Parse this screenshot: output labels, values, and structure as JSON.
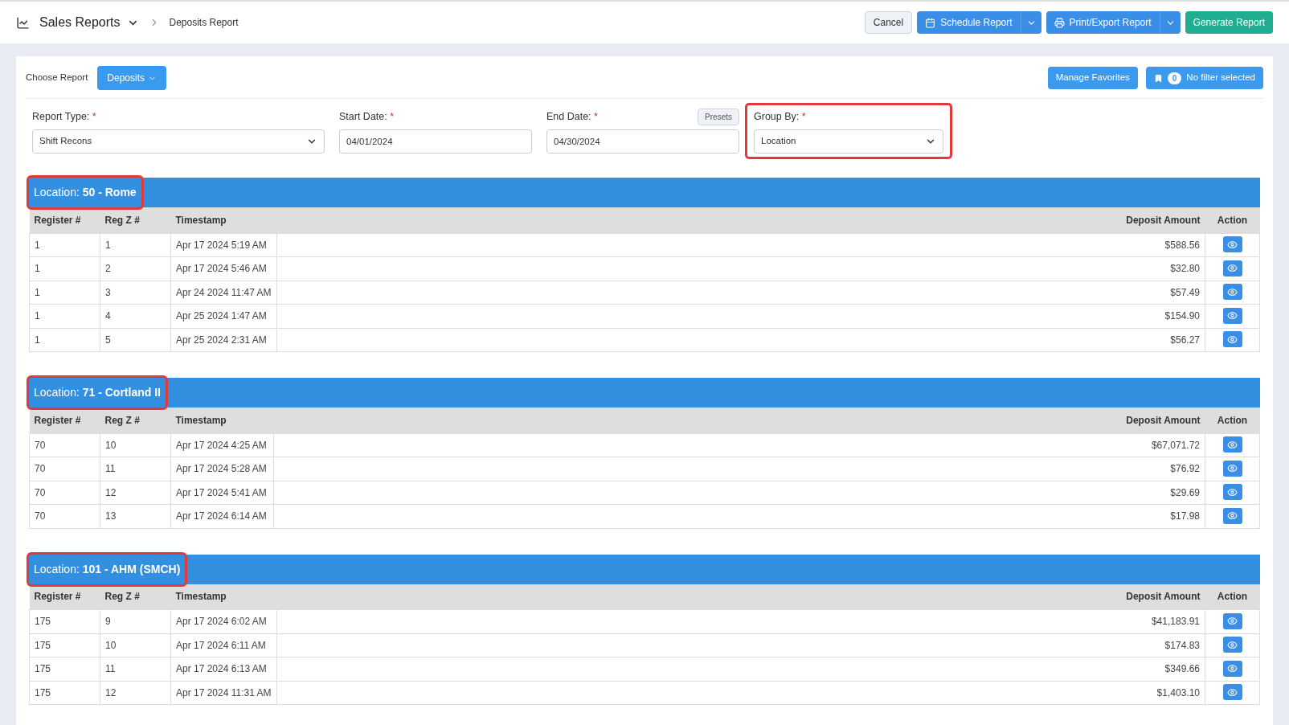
{
  "header": {
    "title": "Sales Reports",
    "breadcrumb": "Deposits Report",
    "buttons": [
      {
        "label": "Cancel",
        "kind": "plain"
      },
      {
        "label": "Schedule Report",
        "kind": "schedule"
      },
      {
        "label": "Print/Export Report",
        "kind": "print"
      },
      {
        "label": "Generate Report",
        "kind": "primary"
      }
    ]
  },
  "choose_report": {
    "label": "Choose Report",
    "value": "Deposits"
  },
  "manage_favorites": "Manage Favorites",
  "filter": {
    "count": "0",
    "label": "No filter selected"
  },
  "fields": [
    {
      "label": "Report Type:",
      "required": "*",
      "kind": "select",
      "value": "Shift Recons",
      "highlighted": false
    },
    {
      "label": "Start Date:",
      "required": "*",
      "kind": "input",
      "value": "04/01/2024",
      "highlighted": false
    },
    {
      "label": "End Date:",
      "required": "*",
      "kind": "input",
      "value": "04/30/2024",
      "presets": "Presets",
      "highlighted": false
    },
    {
      "label": "Group By:",
      "required": "*",
      "kind": "select",
      "value": "Location",
      "highlighted": true
    }
  ],
  "groups": [
    {
      "title": "Location: **50 - Rome**",
      "highlighted": true,
      "columns": [
        "Register #",
        "Reg Z #",
        "Timestamp",
        "Deposit Amount",
        "Action"
      ],
      "rows": [
        [
          "1",
          "1",
          "Apr 17 2024 5:19 AM",
          "$588.56"
        ],
        [
          "1",
          "2",
          "Apr 17 2024 5:46 AM",
          "$32.80"
        ],
        [
          "1",
          "3",
          "Apr 24 2024 11:47 AM",
          "$57.49"
        ],
        [
          "1",
          "4",
          "Apr 25 2024 1:47 AM",
          "$154.90"
        ],
        [
          "1",
          "5",
          "Apr 25 2024 2:31 AM",
          "$56.27"
        ]
      ]
    },
    {
      "title": "Location: **71 - Cortland II**",
      "highlighted": true,
      "columns": [
        "Register #",
        "Reg Z #",
        "Timestamp",
        "Deposit Amount",
        "Action"
      ],
      "rows": [
        [
          "70",
          "10",
          "Apr 17 2024 4:25 AM",
          "$67,071.72"
        ],
        [
          "70",
          "11",
          "Apr 17 2024 5:28 AM",
          "$76.92"
        ],
        [
          "70",
          "12",
          "Apr 17 2024 5:41 AM",
          "$29.69"
        ],
        [
          "70",
          "13",
          "Apr 17 2024 6:14 AM",
          "$17.98"
        ]
      ]
    },
    {
      "title": "Location: **101 - AHM (SMCH)**",
      "highlighted": true,
      "columns": [
        "Register #",
        "Reg Z #",
        "Timestamp",
        "Deposit Amount",
        "Action"
      ],
      "rows": [
        [
          "175",
          "9",
          "Apr 17 2024 6:02 AM",
          "$41,183.91"
        ],
        [
          "175",
          "10",
          "Apr 17 2024 6:11 AM",
          "$174.83"
        ],
        [
          "175",
          "11",
          "Apr 17 2024 6:13 AM",
          "$349.66"
        ],
        [
          "175",
          "12",
          "Apr 17 2024 11:31 AM",
          "$1,403.10"
        ]
      ]
    }
  ]
}
